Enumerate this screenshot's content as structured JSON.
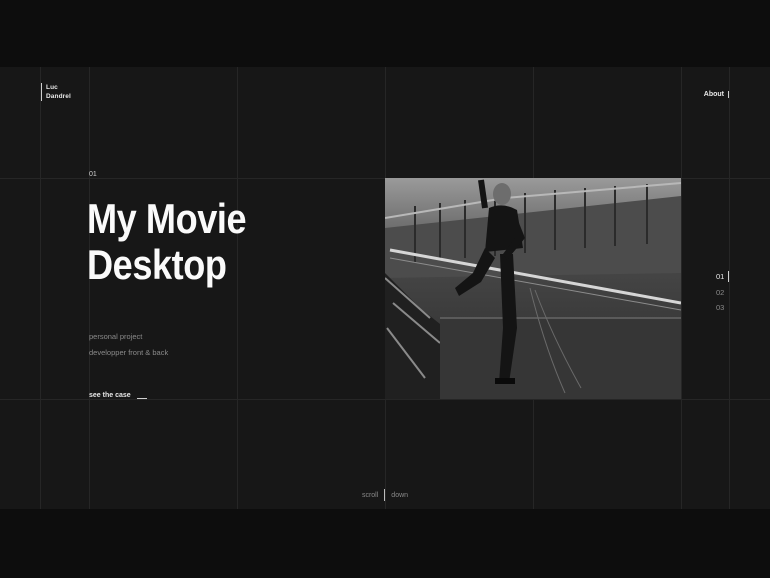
{
  "brand": {
    "line1": "Luc",
    "line2": "Dandrel"
  },
  "nav": {
    "about": "About"
  },
  "project": {
    "number": "01",
    "title_line1": "My Movie",
    "title_line2": "Desktop",
    "meta_line1": "personal project",
    "meta_line2": "developper front & back",
    "cta": "see the case"
  },
  "pager": [
    "01",
    "02",
    "03"
  ],
  "scroll": {
    "left": "scroll",
    "right": "down"
  }
}
